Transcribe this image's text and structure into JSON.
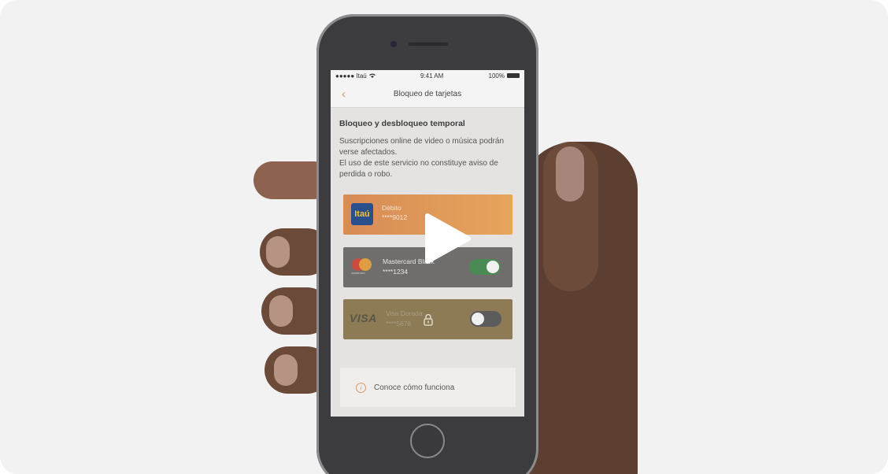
{
  "status_bar": {
    "carrier": "●●●●● Itaú",
    "time": "9:41 AM",
    "battery": "100%"
  },
  "navbar": {
    "title": "Bloqueo de tarjetas"
  },
  "content": {
    "section_title": "Bloqueo y desbloqueo temporal",
    "description_line1": "Suscripciones online de video o música podrán verse afectados.",
    "description_line2": "El uso de este servicio no constituye aviso de perdida o robo."
  },
  "cards": [
    {
      "brand_text": "Itaú",
      "name": "Débito",
      "number": "****9012"
    },
    {
      "brand_text": "mastercard",
      "name": "Mastercard Black",
      "number": "****1234",
      "toggle_on": true
    },
    {
      "brand_text": "VISA",
      "name": "Visa Dorada",
      "number": "****5678",
      "toggle_on": false
    }
  ],
  "info": {
    "label": "Conoce cómo funciona"
  },
  "colors": {
    "accent": "#d79062",
    "toggle_on": "#4a8a55",
    "debit_card": "#e3a05b"
  },
  "icons": {
    "back": "chevron-left-icon",
    "play": "play-icon",
    "info": "info-icon",
    "lock": "lock-icon"
  }
}
